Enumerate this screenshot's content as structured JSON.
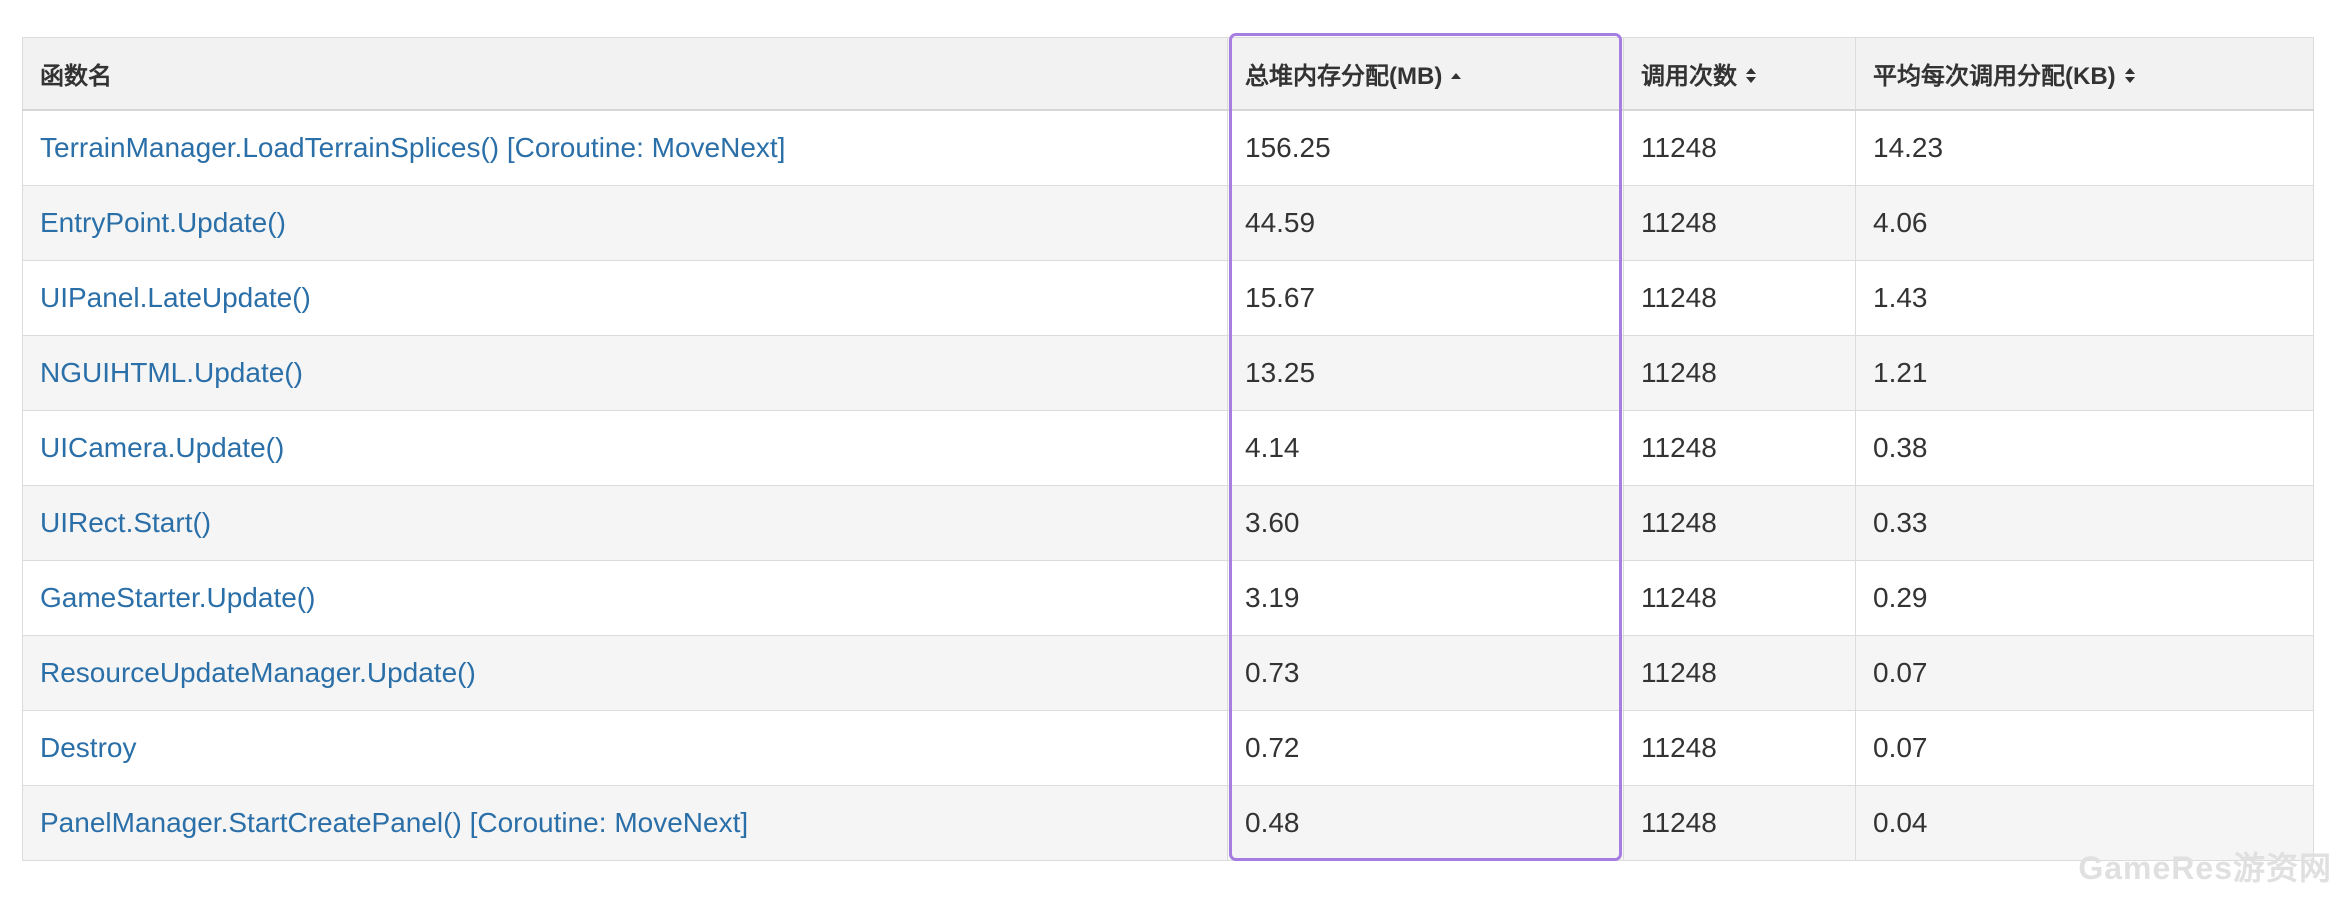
{
  "table": {
    "headers": {
      "function_name": "函数名",
      "total_heap": "总堆内存分配(MB)",
      "call_count": "调用次数",
      "avg_per_call": "平均每次调用分配(KB)"
    },
    "sort": {
      "column": "total_heap",
      "direction": "ascending"
    },
    "rows": [
      {
        "name": "TerrainManager.LoadTerrainSplices() [Coroutine: MoveNext]",
        "total": "156.25",
        "calls": "11248",
        "avg": "14.23"
      },
      {
        "name": "EntryPoint.Update()",
        "total": "44.59",
        "calls": "11248",
        "avg": "4.06"
      },
      {
        "name": "UIPanel.LateUpdate()",
        "total": "15.67",
        "calls": "11248",
        "avg": "1.43"
      },
      {
        "name": "NGUIHTML.Update()",
        "total": "13.25",
        "calls": "11248",
        "avg": "1.21"
      },
      {
        "name": "UICamera.Update()",
        "total": "4.14",
        "calls": "11248",
        "avg": "0.38"
      },
      {
        "name": "UIRect.Start()",
        "total": "3.60",
        "calls": "11248",
        "avg": "0.33"
      },
      {
        "name": "GameStarter.Update()",
        "total": "3.19",
        "calls": "11248",
        "avg": "0.29"
      },
      {
        "name": "ResourceUpdateManager.Update()",
        "total": "0.73",
        "calls": "11248",
        "avg": "0.07"
      },
      {
        "name": "Destroy",
        "total": "0.72",
        "calls": "11248",
        "avg": "0.07"
      },
      {
        "name": "PanelManager.StartCreatePanel() [Coroutine: MoveNext]",
        "total": "0.48",
        "calls": "11248",
        "avg": "0.04"
      }
    ]
  },
  "watermark": "GameRes游资网",
  "colors": {
    "link": "#2b6fa8",
    "highlight_border": "#a67de0",
    "header_bg": "#f2f2f2",
    "stripe_bg": "#f5f5f5"
  }
}
